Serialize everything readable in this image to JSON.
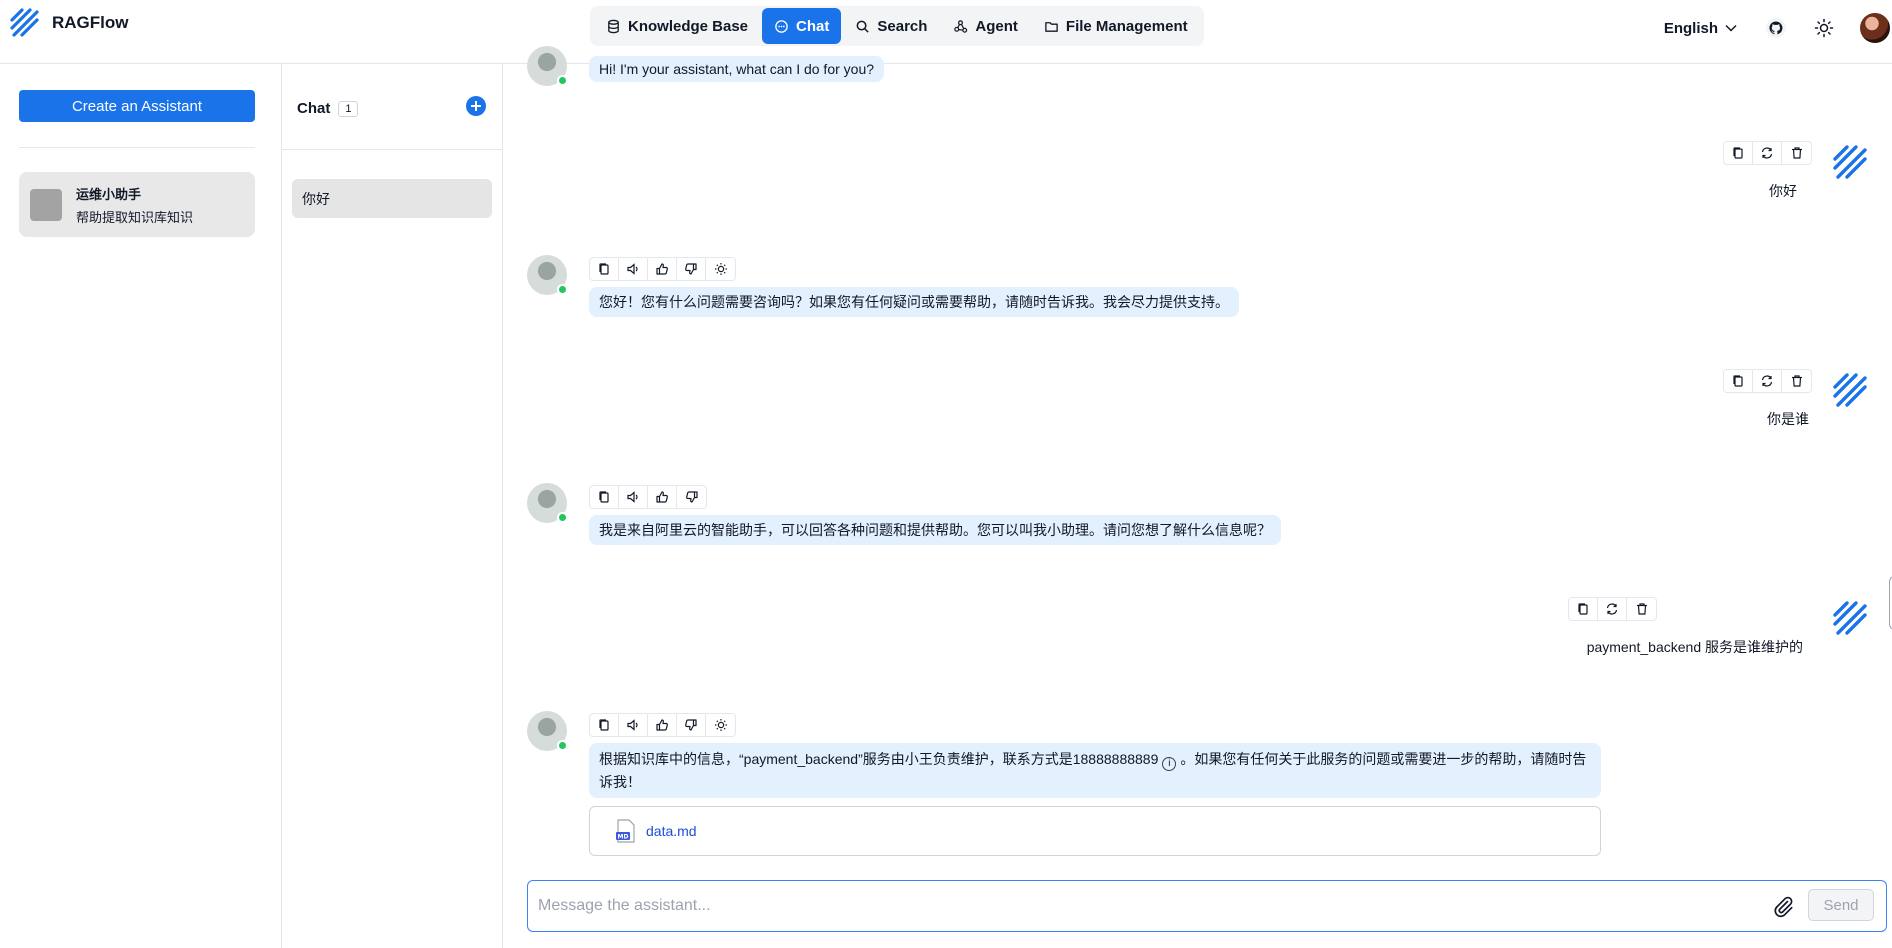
{
  "app": {
    "name": "RAGFlow"
  },
  "nav": {
    "items": [
      {
        "label": "Knowledge Base",
        "icon": "database-icon",
        "active": false
      },
      {
        "label": "Chat",
        "icon": "chat-bubble-icon",
        "active": true
      },
      {
        "label": "Search",
        "icon": "search-icon",
        "active": false
      },
      {
        "label": "Agent",
        "icon": "agent-graph-icon",
        "active": false
      },
      {
        "label": "File Management",
        "icon": "folder-icon",
        "active": false
      }
    ]
  },
  "header": {
    "language": "English"
  },
  "sidebar": {
    "create_label": "Create an Assistant",
    "assistant": {
      "name": "运维小助手",
      "description": "帮助提取知识库知识"
    }
  },
  "conversations": {
    "title": "Chat",
    "count": "1",
    "items": [
      {
        "label": "你好"
      }
    ]
  },
  "messages": [
    {
      "role": "assistant",
      "text": "Hi! I'm your assistant, what can I do for you?"
    },
    {
      "role": "user",
      "text": "你好"
    },
    {
      "role": "assistant",
      "text": "您好！您有什么问题需要咨询吗？如果您有任何疑问或需要帮助，请随时告诉我。我会尽力提供支持。"
    },
    {
      "role": "user",
      "text": "你是谁"
    },
    {
      "role": "assistant",
      "text": "我是来自阿里云的智能助手，可以回答各种问题和提供帮助。您可以叫我小助理。请问您想了解什么信息呢？"
    },
    {
      "role": "user",
      "text": "payment_backend 服务是谁维护的"
    },
    {
      "role": "assistant",
      "text_before": "根据知识库中的信息，“payment_backend”服务由小王负责维护，联系方式是18888888889",
      "text_after": "。如果您有任何关于此服务的问题或需要进一步的帮助，请随时告诉我！",
      "info_glyph": "i"
    }
  ],
  "reference_file": {
    "name": "data.md",
    "badge": "MD"
  },
  "composer": {
    "placeholder": "Message the assistant...",
    "send_label": "Send"
  },
  "colors": {
    "accent": "#1a73e8",
    "bubble": "#e3f0fd",
    "online": "#22c55e"
  }
}
